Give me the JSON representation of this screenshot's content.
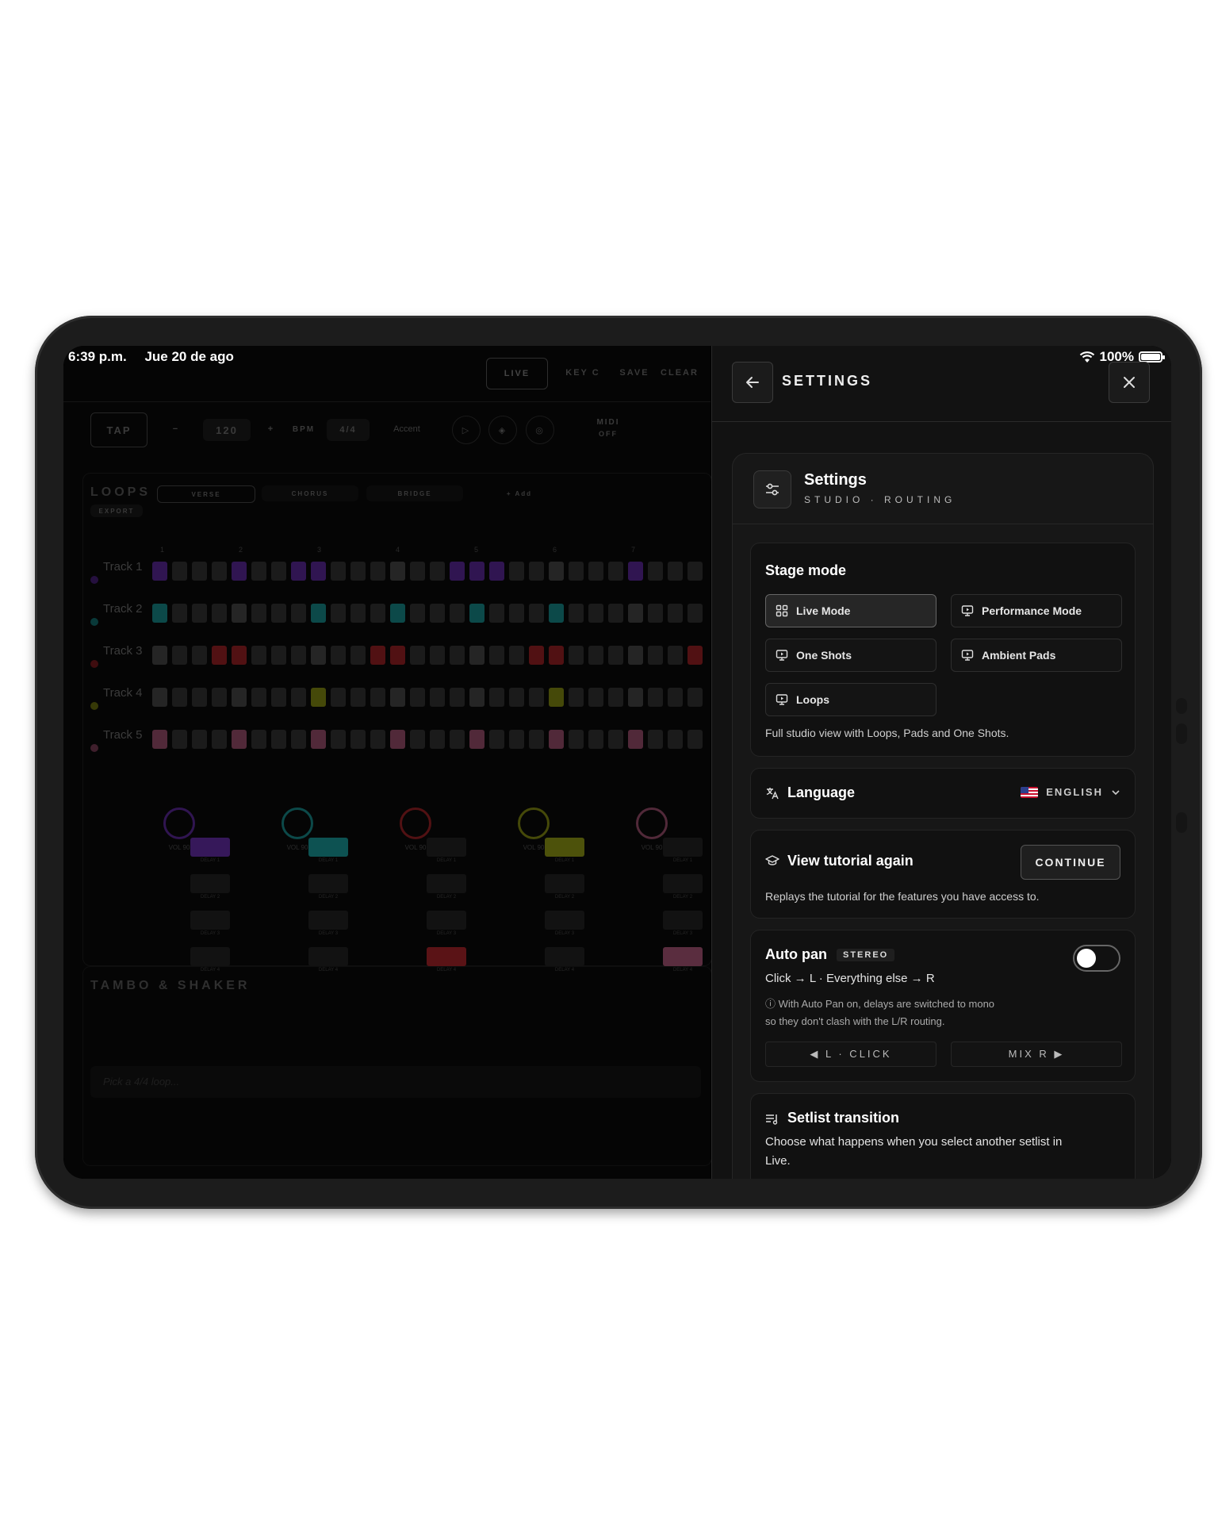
{
  "status_bar": {
    "time": "6:39 p.m.",
    "date": "Jue 20 de ago",
    "battery": "100%"
  },
  "background_app": {
    "top": {
      "live": "LIVE",
      "key": "KEY C",
      "save": "SAVE",
      "clear": "CLEAR"
    },
    "transport": {
      "tap": "TAP",
      "bpm_value": "120",
      "bpm_label": "BPM",
      "time_sig": "4/4",
      "accent": "Accent",
      "midi": "MIDI",
      "midi_state": "OFF"
    },
    "loops": {
      "title": "LOOPS",
      "export": "EXPORT",
      "tabs": [
        "VERSE",
        "CHORUS",
        "BRIDGE",
        "+ Add"
      ]
    },
    "step_numbers": [
      "1",
      "2",
      "3",
      "4",
      "5",
      "6",
      "7"
    ],
    "tracks": [
      {
        "name": "Track 1",
        "color": "#6b2fb3"
      },
      {
        "name": "Track 2",
        "color": "#1aa3a3"
      },
      {
        "name": "Track 3",
        "color": "#b3262b"
      },
      {
        "name": "Track 4",
        "color": "#9aa315"
      },
      {
        "name": "Track 5",
        "color": "#b35a7e"
      }
    ],
    "knob_label": "VOL",
    "knob_value": "90",
    "fx_labels": [
      "DELAY 1",
      "DELAY 2",
      "DELAY 3",
      "DELAY 4"
    ],
    "section_title": "TAMBO & SHAKER",
    "loop_picker_placeholder": "Pick a 4/4 loop..."
  },
  "settings": {
    "header_title": "SETTINGS",
    "card_title": "Settings",
    "card_subtitle": "STUDIO · ROUTING",
    "stage_mode": {
      "title": "Stage mode",
      "options": [
        "Live Mode",
        "Performance Mode",
        "One Shots",
        "Ambient Pads",
        "Loops"
      ],
      "selected": "Live Mode",
      "description": "Full studio view with Loops, Pads and One Shots."
    },
    "language": {
      "title": "Language",
      "value": "ENGLISH"
    },
    "tutorial": {
      "title": "View tutorial again",
      "button": "CONTINUE",
      "description": "Replays the tutorial for the features you have access to."
    },
    "auto_pan": {
      "title": "Auto pan",
      "badge": "STEREO",
      "routing": "Click → L · Everything else → R",
      "note_line1": "ⓘ With Auto Pan on, delays are switched to mono",
      "note_line2": "so they don't clash with the L/R routing.",
      "left_button": "◀ L · CLICK",
      "right_button": "MIX R ▶",
      "enabled": false
    },
    "setlist": {
      "title": "Setlist transition",
      "description_line1": "Choose what happens when you select another setlist in",
      "description_line2": "Live."
    }
  }
}
